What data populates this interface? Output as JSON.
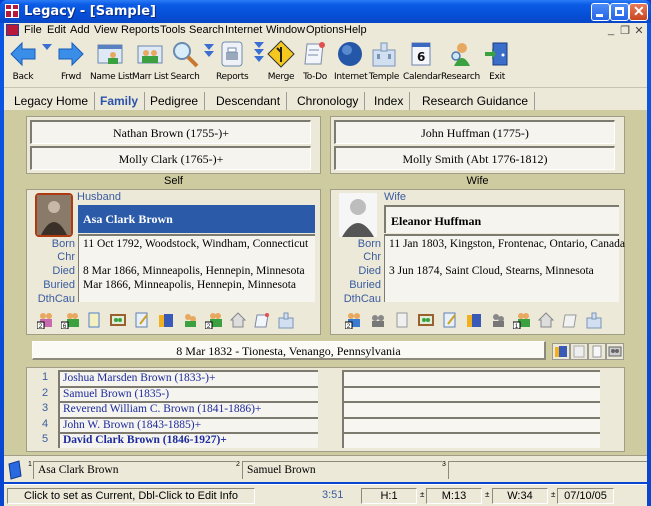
{
  "window": {
    "title": "Legacy - [Sample]"
  },
  "menu": [
    "File",
    "Edit",
    "Add",
    "View",
    "Reports",
    "Tools",
    "Search",
    "Internet",
    "Window",
    "Options",
    "Help"
  ],
  "toolbar": [
    {
      "label": "Back",
      "icon": "back-arrow-icon"
    },
    {
      "label": "Frwd",
      "icon": "forward-arrow-icon"
    },
    {
      "label": "Name List",
      "icon": "name-list-icon"
    },
    {
      "label": "Marr List",
      "icon": "marriage-list-icon"
    },
    {
      "label": "Search",
      "icon": "magnifier-icon"
    },
    {
      "label": "Reports",
      "icon": "printer-icon"
    },
    {
      "label": "Merge",
      "icon": "merge-sign-icon"
    },
    {
      "label": "To-Do",
      "icon": "todo-list-icon"
    },
    {
      "label": "Internet",
      "icon": "globe-icon"
    },
    {
      "label": "Temple",
      "icon": "temple-icon"
    },
    {
      "label": "Calendar",
      "icon": "calendar-icon"
    },
    {
      "label": "Research",
      "icon": "research-icon"
    },
    {
      "label": "Exit",
      "icon": "exit-door-icon"
    }
  ],
  "calendar_day": "6",
  "tabs": [
    {
      "label": "Legacy Home",
      "active": false
    },
    {
      "label": "Family",
      "active": true
    },
    {
      "label": "Pedigree",
      "active": false
    },
    {
      "label": "Descendant",
      "active": false
    },
    {
      "label": "Chronology",
      "active": false
    },
    {
      "label": "Index",
      "active": false
    },
    {
      "label": "Research Guidance",
      "active": false
    }
  ],
  "self_parents": {
    "father": "Nathan Brown (1755-)+",
    "mother": "Molly Clark (1765-)+",
    "label": "Self"
  },
  "wife_parents": {
    "father": "John Huffman (1775-)",
    "mother": "Molly Smith (Abt 1776-1812)",
    "label": "Wife"
  },
  "husband": {
    "role": "Husband",
    "name": "Asa Clark Brown",
    "facts": [
      {
        "label": "Born",
        "value": "11 Oct 1792, Woodstock, Windham, Connecticut"
      },
      {
        "label": "Chr",
        "value": ""
      },
      {
        "label": "Died",
        "value": "8 Mar 1866, Minneapolis, Hennepin, Minnesota"
      },
      {
        "label": "Buried",
        "value": "Mar 1866, Minneapolis, Hennepin, Minnesota"
      },
      {
        "label": "DthCau",
        "value": ""
      }
    ],
    "icon_badges": {
      "spouses": "2",
      "children": "6",
      "parents": "2"
    }
  },
  "wife": {
    "role": "Wife",
    "name": "Eleanor Huffman",
    "facts": [
      {
        "label": "Born",
        "value": "11 Jan 1803, Kingston, Frontenac, Ontario, Canada"
      },
      {
        "label": "Chr",
        "value": ""
      },
      {
        "label": "Died",
        "value": "3 Jun 1874, Saint Cloud, Stearns, Minnesota"
      },
      {
        "label": "Buried",
        "value": ""
      },
      {
        "label": "DthCau",
        "value": ""
      }
    ],
    "icon_badges": {
      "spouses": "2",
      "parents": "1"
    }
  },
  "marriage": "8 Mar 1832 - Tionesta, Venango, Pennsylvania",
  "children": [
    {
      "num": "1",
      "name": "Joshua Marsden Brown (1833-)+",
      "bold": false
    },
    {
      "num": "2",
      "name": "Samuel Brown (1835-)",
      "bold": false
    },
    {
      "num": "3",
      "name": "Reverend William C. Brown (1841-1886)+",
      "bold": false
    },
    {
      "num": "4",
      "name": "John W. Brown (1843-1885)+",
      "bold": false
    },
    {
      "num": "5",
      "name": "David Clark Brown (1846-1927)+",
      "bold": true
    }
  ],
  "bookmarks": [
    {
      "num": "1",
      "name": "Asa Clark Brown"
    },
    {
      "num": "2",
      "name": "Samuel Brown"
    },
    {
      "num": "3",
      "name": ""
    }
  ],
  "status": {
    "message": "Click to set as Current, Dbl-Click to Edit Info",
    "time": "3:51",
    "h": "H:1",
    "m": "M:13",
    "w": "W:34",
    "date": "07/10/05"
  },
  "colors": {
    "accent": "#2b58a8",
    "name_highlight": "#2b5aa8",
    "child_link": "#1c2a9e",
    "label_blue": "#3a5ca0"
  }
}
